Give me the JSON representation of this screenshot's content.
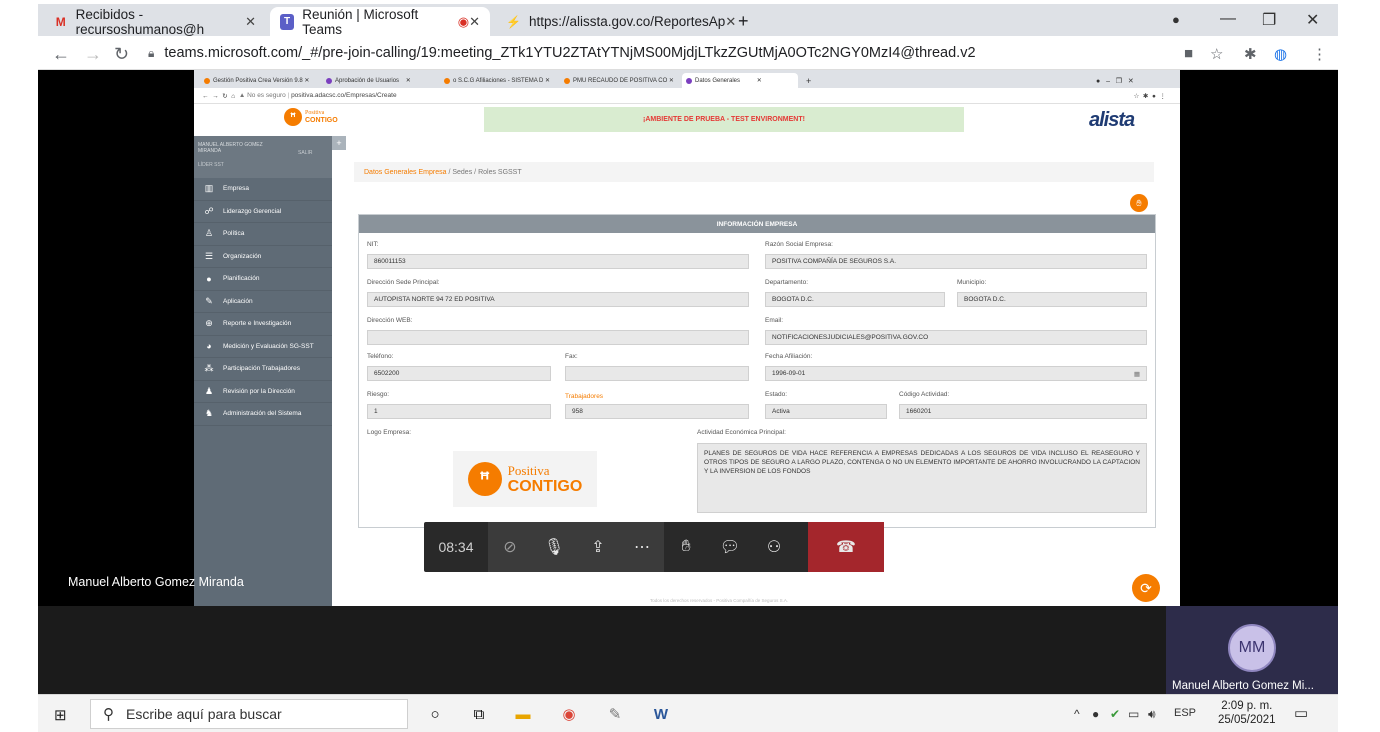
{
  "browser": {
    "tabs": [
      {
        "label": "Recibidos - recursoshumanos@h",
        "icon": "gmail-icon"
      },
      {
        "label": "Reunión | Microsoft Teams",
        "icon": "teams-icon"
      },
      {
        "label": "https://alissta.gov.co/ReportesAp",
        "icon": "alissta-icon"
      }
    ],
    "new_tab": "+",
    "url": "teams.microsoft.com/_#/pre-join-calling/19:meeting_ZTk1YTU2ZTAtYTNjMS00MjdjLTkzZGUtMjA0OTc2NGY0MzI4@thread.v2"
  },
  "nested_browser": {
    "tabs": [
      "Gestión Positiva Crea Versión 9.8",
      "Aprobación de Usuarios",
      "o S.C.G Afiliaciones - SISTEMA D",
      "PMU RECAUDO DE POSITIVA CO",
      "Datos Generales"
    ],
    "address_prefix": "No es seguro",
    "address": "positiva.adacsc.co/Empresas/Create"
  },
  "app": {
    "logo_top": "Positiva",
    "logo_bottom": "CONTIGO",
    "env_banner": "¡AMBIENTE DE PRUEBA - TEST ENVIRONMENT!",
    "brand": "alista",
    "user_name": "MANUEL ALBERTO GOMEZ MIRANDA",
    "user_role": "LÍDER SST",
    "logout": "SALIR",
    "side_toggle": "+",
    "menu": [
      {
        "label": "Empresa",
        "icon": "building-icon"
      },
      {
        "label": "Liderazgo Gerencial",
        "icon": "sitemap-icon"
      },
      {
        "label": "Política",
        "icon": "person-icon"
      },
      {
        "label": "Organización",
        "icon": "list-icon"
      },
      {
        "label": "Planificación",
        "icon": "user-gear-icon"
      },
      {
        "label": "Aplicación",
        "icon": "pencil-icon"
      },
      {
        "label": "Reporte e Investigación",
        "icon": "magnifier-icon"
      },
      {
        "label": "Medición y Evaluación SG-SST",
        "icon": "pie-chart-icon"
      },
      {
        "label": "Participación Trabajadores",
        "icon": "group-icon"
      },
      {
        "label": "Revisión por la Dirección",
        "icon": "user-review-icon"
      },
      {
        "label": "Administración del Sistema",
        "icon": "user-admin-icon"
      }
    ],
    "breadcrumb": [
      "Datos Generales Empresa",
      "Sedes",
      "Roles SGSST"
    ],
    "breadcrumb_sep": "/",
    "panel_title": "INFORMACIÓN EMPRESA",
    "fields": {
      "nit_label": "NIT:",
      "nit": "860011153",
      "razon_label": "Razón Social Empresa:",
      "razon": "POSITIVA COMPAÑÍA DE SEGUROS S.A.",
      "direccion_label": "Dirección Sede Principal:",
      "direccion": "AUTOPISTA NORTE 94 72 ED POSITIVA",
      "departamento_label": "Departamento:",
      "departamento": "BOGOTA D.C.",
      "municipio_label": "Municipio:",
      "municipio": "BOGOTA D.C.",
      "web_label": "Dirección WEB:",
      "web": "",
      "email_label": "Email:",
      "email": "NOTIFICACIONESJUDICIALES@POSITIVA.GOV.CO",
      "telefono_label": "Teléfono:",
      "telefono": "6502200",
      "fax_label": "Fax:",
      "fax": "",
      "fecha_label": "Fecha Afiliación:",
      "fecha": "1996-09-01",
      "riesgo_label": "Riesgo:",
      "riesgo": "1",
      "trabajadores_label": "Trabajadores",
      "trabajadores": "958",
      "estado_label": "Estado:",
      "estado": "Activa",
      "codigo_label": "Código Actividad:",
      "codigo": "1660201",
      "logo_label": "Logo Empresa:",
      "actividad_label": "Actividad Económica Principal:",
      "actividad": "PLANES DE SEGUROS DE VIDA HACE REFERENCIA A EMPRESAS DEDICADAS A LOS SEGUROS DE VIDA INCLUSO EL REASEGURO Y OTROS TIPOS DE SEGURO A LARGO PLAZO, CONTENGA O NO UN ELEMENTO IMPORTANTE DE AHORRO INVOLUCRANDO LA CAPTACION Y LA INVERSION DE LOS FONDOS"
    },
    "company_logo_top": "Positiva",
    "company_logo_bottom": "CONTIGO",
    "footer": "Todos los derechos reservados - Positiva Compañía de Seguros S.A."
  },
  "teams": {
    "timer": "08:34",
    "presenter_name": "Manuel Alberto Gomez Miranda",
    "tile_initials": "MM",
    "tile_name": "Manuel Alberto Gomez Mi..."
  },
  "taskbar": {
    "search_placeholder": "Escribe aquí para buscar",
    "lang": "ESP",
    "time": "2:09 p. m.",
    "date": "25/05/2021"
  }
}
